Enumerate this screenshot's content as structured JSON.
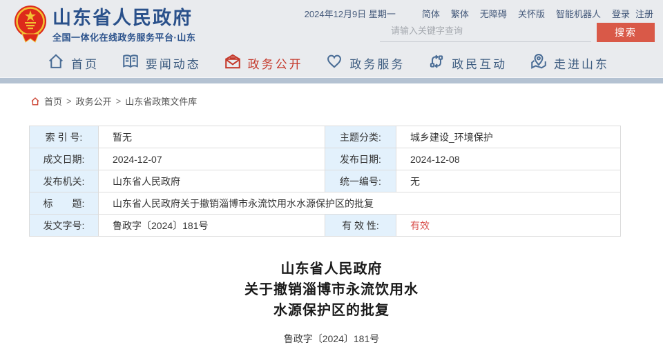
{
  "colors": {
    "accent_red": "#c5382a",
    "search_button_red": "#d95948",
    "title_blue": "#2a518b",
    "nav_text_blue": "#3d5c80",
    "strip_blue": "#b4c2d2",
    "header_bg": "#e9ebee",
    "table_label_bg": "#e3f1fc",
    "table_border": "#dcdcdc",
    "valid_red": "#d9534f"
  },
  "header": {
    "logo_icon": "national-emblem-icon",
    "site_title": "山东省人民政府",
    "site_subtitle": "全国一体化在线政务服务平台·山东",
    "date_text": "2024年12月9日 星期一",
    "quick_links": [
      "简体",
      "繁体",
      "无障碍",
      "关怀版",
      "智能机器人",
      "登录",
      "注册"
    ],
    "search": {
      "placeholder": "请输入关键字查询",
      "button_label": "搜索"
    }
  },
  "nav": {
    "items": [
      {
        "label": "首页",
        "icon": "home-icon",
        "active": false
      },
      {
        "label": "要闻动态",
        "icon": "book-icon",
        "active": false
      },
      {
        "label": "政务公开",
        "icon": "mail-icon",
        "active": true
      },
      {
        "label": "政务服务",
        "icon": "heart-icon",
        "active": false
      },
      {
        "label": "政民互动",
        "icon": "chat-arrows-icon",
        "active": false
      },
      {
        "label": "走进山东",
        "icon": "map-pin-icon",
        "active": false
      }
    ]
  },
  "breadcrumb": {
    "separator": ">",
    "items": [
      "首页",
      "政务公开",
      "山东省政策文件库"
    ]
  },
  "meta_table": {
    "row1": {
      "l1": "索 引 号:",
      "v1": "暂无",
      "l2": "主题分类:",
      "v2": "城乡建设_环境保护"
    },
    "row2": {
      "l1": "成文日期:",
      "v1": "2024-12-07",
      "l2": "发布日期:",
      "v2": "2024-12-08"
    },
    "row3": {
      "l1": "发布机关:",
      "v1": "山东省人民政府",
      "l2": "统一编号:",
      "v2": "无"
    },
    "row4": {
      "l1": "标　　题:",
      "v1": "山东省人民政府关于撤销淄博市永流饮用水水源保护区的批复"
    },
    "row5": {
      "l1": "发文字号:",
      "v1": "鲁政字〔2024〕181号",
      "l2": "有 效 性:",
      "v2": "有效"
    }
  },
  "document": {
    "title_line1": "山东省人民政府",
    "title_line2": "关于撤销淄博市永流饮用水",
    "title_line3": "水源保护区的批复",
    "doc_number": "鲁政字〔2024〕181号"
  }
}
